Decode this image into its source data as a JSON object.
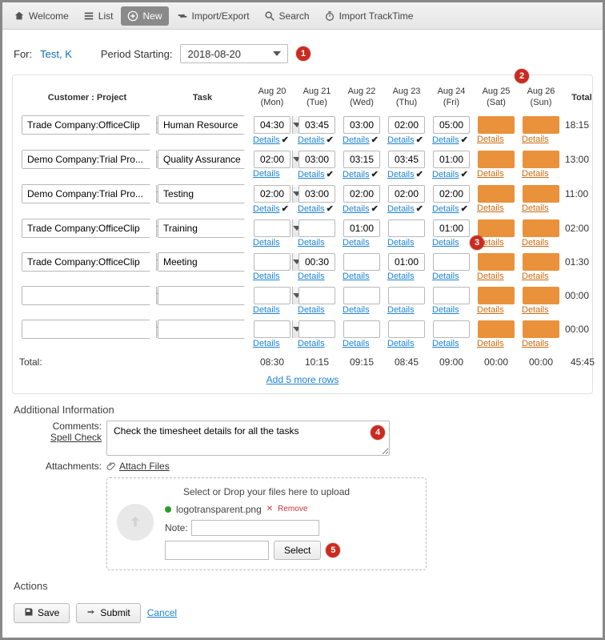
{
  "toolbar": {
    "welcome": "Welcome",
    "list": "List",
    "new": "New",
    "import_export": "Import/Export",
    "search": "Search",
    "import_tracktime": "Import TrackTime"
  },
  "for_label": "For:",
  "for_name": "Test, K",
  "period_label": "Period Starting:",
  "period_value": "2018-08-20",
  "annotations": {
    "b1": "1",
    "b2": "2",
    "b3": "3",
    "b4": "4",
    "b5": "5"
  },
  "headers": {
    "customer": "Customer : Project",
    "task": "Task",
    "days": [
      {
        "top": "Aug 20",
        "bot": "(Mon)"
      },
      {
        "top": "Aug 21",
        "bot": "(Tue)"
      },
      {
        "top": "Aug 22",
        "bot": "(Wed)"
      },
      {
        "top": "Aug 23",
        "bot": "(Thu)"
      },
      {
        "top": "Aug 24",
        "bot": "(Fri)"
      },
      {
        "top": "Aug 25",
        "bot": "(Sat)"
      },
      {
        "top": "Aug 26",
        "bot": "(Sun)"
      }
    ],
    "total": "Total"
  },
  "details_label": "Details",
  "rows": [
    {
      "customer": "Trade Company:OfficeClip",
      "task": "Human Resource",
      "vals": [
        "04:30",
        "03:45",
        "03:00",
        "02:00",
        "05:00",
        "",
        ""
      ],
      "checks": [
        true,
        true,
        true,
        true,
        true,
        false,
        false
      ],
      "total": "18:15"
    },
    {
      "customer": "Demo Company:Trial Pro...",
      "task": "Quality Assurance",
      "vals": [
        "02:00",
        "03:00",
        "03:15",
        "03:45",
        "01:00",
        "",
        ""
      ],
      "checks": [
        false,
        true,
        true,
        true,
        true,
        false,
        false
      ],
      "total": "13:00"
    },
    {
      "customer": "Demo Company:Trial Pro...",
      "task": "Testing",
      "vals": [
        "02:00",
        "03:00",
        "02:00",
        "02:00",
        "02:00",
        "",
        ""
      ],
      "checks": [
        true,
        true,
        true,
        true,
        true,
        false,
        false
      ],
      "total": "11:00"
    },
    {
      "customer": "Trade Company:OfficeClip",
      "task": "Training",
      "vals": [
        "",
        "",
        "01:00",
        "",
        "01:00",
        "",
        ""
      ],
      "checks": [
        false,
        false,
        false,
        false,
        false,
        false,
        false
      ],
      "total": "02:00"
    },
    {
      "customer": "Trade Company:OfficeClip",
      "task": "Meeting",
      "vals": [
        "",
        "00:30",
        "",
        "01:00",
        "",
        "",
        ""
      ],
      "checks": [
        false,
        false,
        false,
        false,
        false,
        false,
        false
      ],
      "total": "01:30"
    },
    {
      "customer": "",
      "task": "",
      "vals": [
        "",
        "",
        "",
        "",
        "",
        "",
        ""
      ],
      "checks": [
        false,
        false,
        false,
        false,
        false,
        false,
        false
      ],
      "total": "00:00"
    },
    {
      "customer": "",
      "task": "",
      "vals": [
        "",
        "",
        "",
        "",
        "",
        "",
        ""
      ],
      "checks": [
        false,
        false,
        false,
        false,
        false,
        false,
        false
      ],
      "total": "00:00"
    }
  ],
  "col_totals_label": "Total:",
  "col_totals": [
    "08:30",
    "10:15",
    "09:15",
    "08:45",
    "09:00",
    "00:00",
    "00:00"
  ],
  "grand_total": "45:45",
  "add_more": "Add 5 more rows",
  "addl_info_title": "Additional Information",
  "comments_label": "Comments:",
  "spell_check": "Spell Check",
  "comments_value": "Check the timesheet details for all the tasks",
  "attachments_label": "Attachments:",
  "attach_files": "Attach Files",
  "upload_msg": "Select or Drop your files here to upload",
  "file_name": "logotransparent.png",
  "remove_label": "Remove",
  "note_label": "Note:",
  "select_btn": "Select",
  "actions_title": "Actions",
  "save": "Save",
  "submit": "Submit",
  "cancel": "Cancel"
}
